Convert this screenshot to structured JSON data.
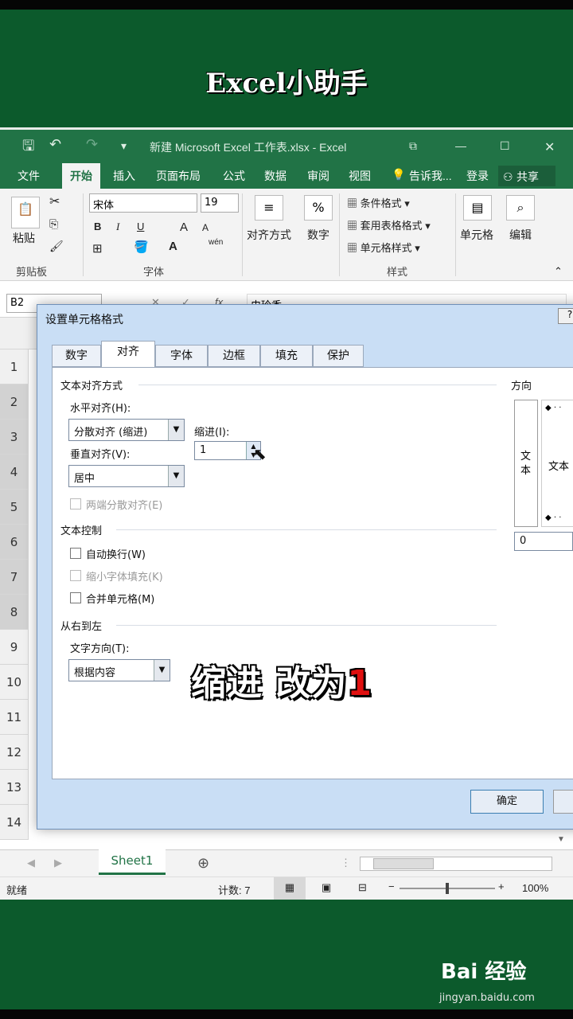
{
  "banner_title": "Excel小助手",
  "excel": {
    "window_title": "新建 Microsoft Excel 工作表.xlsx - Excel",
    "ribbon_tabs": [
      "文件",
      "开始",
      "插入",
      "页面布局",
      "公式",
      "数据",
      "审阅",
      "视图",
      "告诉我...",
      "登录"
    ],
    "share_label": "共享",
    "clipboard": {
      "paste": "粘贴",
      "group": "剪贴板"
    },
    "font": {
      "name": "宋体",
      "size": "19",
      "bold": "B",
      "italic": "I",
      "underline": "U",
      "group": "字体",
      "grow": "A",
      "shrink": "A",
      "phonetic": "wén"
    },
    "alignment_label": "对齐方式",
    "number_label": "数字",
    "styles": {
      "items": [
        "条件格式",
        "套用表格格式",
        "单元格样式"
      ],
      "group": "样式"
    },
    "cells_label": "单元格",
    "editing_label": "编辑",
    "name_box": "B2",
    "formula_value": "史玲香",
    "row_headers": [
      "1",
      "2",
      "3",
      "4",
      "5",
      "6",
      "7",
      "8",
      "9",
      "10",
      "11",
      "12",
      "13",
      "14"
    ],
    "sheet_tab": "Sheet1",
    "status": {
      "ready": "就绪",
      "count": "计数: 7",
      "zoom": "100%"
    }
  },
  "dialog": {
    "title": "设置单元格格式",
    "tabs": [
      "数字",
      "对齐",
      "字体",
      "边框",
      "填充",
      "保护"
    ],
    "active_tab": "对齐",
    "text_alignment_section": "文本对齐方式",
    "horizontal_label": "水平对齐(H):",
    "horizontal_value": "分散对齐 (缩进)",
    "indent_label": "缩进(I):",
    "indent_value": "1",
    "vertical_label": "垂直对齐(V):",
    "vertical_value": "居中",
    "justify_distributed": "两端分散对齐(E)",
    "text_control_section": "文本控制",
    "wrap_text": "自动换行(W)",
    "shrink_to_fit": "缩小字体填充(K)",
    "merge_cells": "合并单元格(M)",
    "rtl_section": "从右到左",
    "text_direction_label": "文字方向(T):",
    "text_direction_value": "根据内容",
    "orientation_section": "方向",
    "orientation_vertical_text": "文本",
    "orientation_text": "文本",
    "degrees_value": "0",
    "ok_button": "确定"
  },
  "overlay_caption": {
    "text": "缩进 改为",
    "number": "1"
  },
  "watermark": {
    "brand": "Bai 经验",
    "url": "jingyan.baidu.com"
  }
}
